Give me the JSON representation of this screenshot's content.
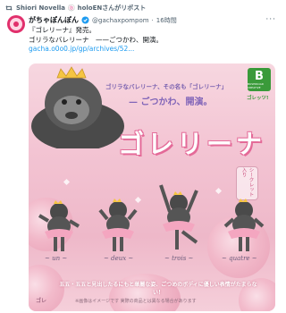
{
  "repost": {
    "text": "Shiori Novella 🍥 holoENさんがリポスト"
  },
  "tweet": {
    "display_name": "がちゃぽんぽん",
    "handle": "@gachaxpompom",
    "separator": "·",
    "time": "16時間",
    "line1": "『ゴレリーナ』発売。",
    "line2": "ゴリラなバレリーナ　——ごつかわ、開演。",
    "link": "gacha.o0o0.jp/gp/archives/52..."
  },
  "media": {
    "tagline_top": "ゴリラなバレリーナ、その名も「ゴレリーナ」",
    "tagline_main": "— ごつかわ、開演。",
    "title": "ゴレリーナ",
    "secret_badge": "シークレット入り",
    "brand_logo_letter": "B",
    "brand_logo_text": "BUSHIROAD CREATIVE",
    "brand_sub": "ゴレッツ!",
    "figure_labels": [
      "~ un ~",
      "~ deux ~",
      "~ trois ~",
      "~ quatre ~"
    ],
    "bottom_copy": "五五・五五と見出したるにもと華麗な姿、ごつめのボディに優しい表情がたまらない！",
    "caption_small": "※画像はイメージです 実際の商品とは異なる場合があります",
    "bottom_logo": "ゴレ"
  },
  "colors": {
    "accent_link": "#1d9bf0",
    "title_outline": "#e46a98",
    "media_pink": "#f3c4d3",
    "brand_green": "#3a9a3a"
  },
  "icons": {
    "repost": "repost-icon",
    "verified": "verified-badge-icon",
    "more": "more-options-icon"
  }
}
